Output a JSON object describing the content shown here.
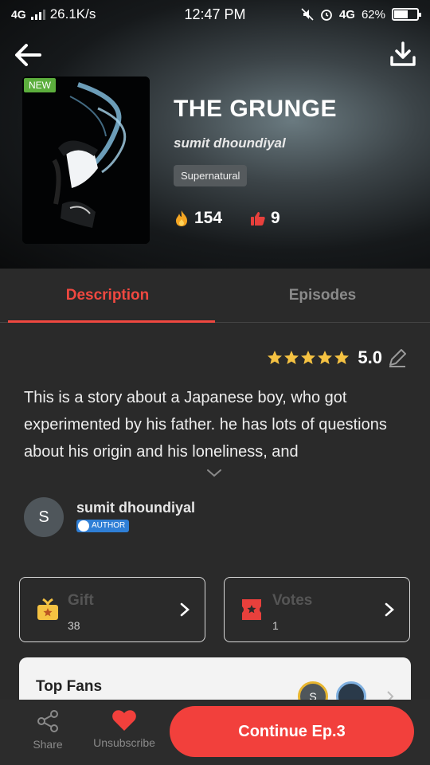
{
  "status_bar": {
    "network": "4G",
    "speed": "26.1K/s",
    "time": "12:47 PM",
    "mobile_data": "4G",
    "battery": "62%",
    "battery_level": 0.62
  },
  "book": {
    "badge": "NEW",
    "title": "THE GRUNGE",
    "author": "sumit dhoundiyal",
    "genre": "Supernatural",
    "fire_count": "154",
    "like_count": "9"
  },
  "tabs": [
    {
      "label": "Description",
      "active": true
    },
    {
      "label": "Episodes",
      "active": false
    }
  ],
  "rating": {
    "value": "5.0",
    "stars": 5
  },
  "description": "This is a story about a Japanese boy, who got experimented by his father. he has lots of questions about his origin and his loneliness, and",
  "author_section": {
    "initial": "S",
    "name": "sumit dhoundiyal",
    "tag": "AUTHOR"
  },
  "gift": {
    "label": "Gift",
    "count": "38"
  },
  "votes": {
    "label": "Votes",
    "count": "1"
  },
  "fans": {
    "title": "Top Fans",
    "first_initial": "S"
  },
  "bottom_bar": {
    "share": "Share",
    "unsubscribe": "Unsubscribe",
    "continue": "Continue Ep.3"
  },
  "colors": {
    "accent": "#f2403c",
    "new_badge": "#5cae3d",
    "star": "#f5c242",
    "author_tag": "#2f7fd6"
  },
  "icons": [
    "back-arrow-icon",
    "download-icon",
    "fire-icon",
    "thumbs-up-icon",
    "edit-pencil-icon",
    "chevron-down-icon",
    "gift-icon",
    "ticket-icon",
    "chevron-right-icon",
    "share-icon",
    "heart-icon"
  ]
}
